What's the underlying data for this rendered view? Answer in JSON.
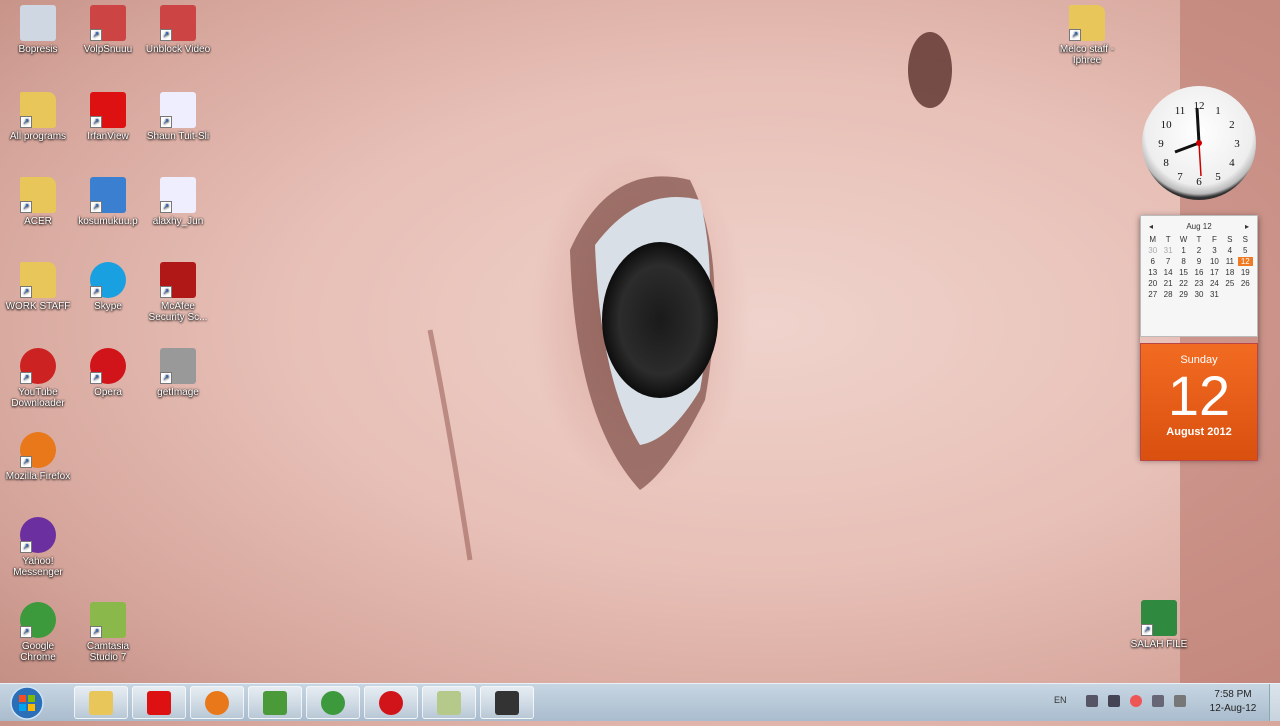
{
  "desktop_icons": [
    {
      "label": "Bopresis",
      "icon": "recycle-bin-icon"
    },
    {
      "label": "VolpSnuuu",
      "icon": "app-icon"
    },
    {
      "label": "Unblock Video",
      "icon": "app-icon"
    },
    {
      "label": "All programs",
      "icon": "folder-icon"
    },
    {
      "label": "IrfanView",
      "icon": "irfanview-icon"
    },
    {
      "label": "Shaun Tuit-Sli",
      "icon": "audio-file-icon"
    },
    {
      "label": "ACER",
      "icon": "folder-icon"
    },
    {
      "label": "kosumukuu.p",
      "icon": "computer-icon"
    },
    {
      "label": "alaxhy_Jun",
      "icon": "audio-file-icon"
    },
    {
      "label": "WORK STAFF",
      "icon": "folder-icon"
    },
    {
      "label": "Skype",
      "icon": "skype-icon"
    },
    {
      "label": "McAfee Security Sc...",
      "icon": "mcafee-icon"
    },
    {
      "label": "YouTube Downloader",
      "icon": "youtube-downloader-icon"
    },
    {
      "label": "Opera",
      "icon": "opera-icon"
    },
    {
      "label": "getImage",
      "icon": "file-icon"
    },
    {
      "label": "Mozilla Firefox",
      "icon": "firefox-icon"
    },
    {
      "label": "Yahoo! Messenger",
      "icon": "yahoo-messenger-icon"
    },
    {
      "label": "Google Chrome",
      "icon": "chrome-icon"
    },
    {
      "label": "Camtasia Studio 7",
      "icon": "camtasia-icon"
    },
    {
      "label": "Melco staff - Iphree",
      "icon": "folder-icon"
    },
    {
      "label": "SALAH FILE",
      "icon": "spreadsheet-icon"
    }
  ],
  "calendar": {
    "month_label": "Aug 12",
    "weekdays": [
      "M",
      "T",
      "W",
      "T",
      "F",
      "S",
      "S"
    ],
    "days": [
      {
        "d": "30",
        "dim": true
      },
      {
        "d": "31",
        "dim": true
      },
      {
        "d": "1"
      },
      {
        "d": "2"
      },
      {
        "d": "3"
      },
      {
        "d": "4"
      },
      {
        "d": "5"
      },
      {
        "d": "6"
      },
      {
        "d": "7"
      },
      {
        "d": "8"
      },
      {
        "d": "9"
      },
      {
        "d": "10"
      },
      {
        "d": "11"
      },
      {
        "d": "12",
        "today": true
      },
      {
        "d": "13"
      },
      {
        "d": "14"
      },
      {
        "d": "15"
      },
      {
        "d": "16"
      },
      {
        "d": "17"
      },
      {
        "d": "18"
      },
      {
        "d": "19"
      },
      {
        "d": "20"
      },
      {
        "d": "21"
      },
      {
        "d": "22"
      },
      {
        "d": "23"
      },
      {
        "d": "24"
      },
      {
        "d": "25"
      },
      {
        "d": "26"
      },
      {
        "d": "27"
      },
      {
        "d": "28"
      },
      {
        "d": "29"
      },
      {
        "d": "30"
      },
      {
        "d": "31"
      }
    ],
    "day_name": "Sunday",
    "day_number": "12",
    "month_year": "August 2012"
  },
  "clock_gadget": {
    "numbers": [
      "12",
      "1",
      "2",
      "3",
      "4",
      "5",
      "6",
      "7",
      "8",
      "9",
      "10",
      "11"
    ]
  },
  "taskbar": {
    "apps": [
      {
        "name": "explorer",
        "icon": "folder-icon"
      },
      {
        "name": "irfanview",
        "icon": "irfanview-icon"
      },
      {
        "name": "firefox",
        "icon": "firefox-icon"
      },
      {
        "name": "messenger",
        "icon": "messenger-icon"
      },
      {
        "name": "chrome",
        "icon": "chrome-icon"
      },
      {
        "name": "opera",
        "icon": "opera-icon"
      },
      {
        "name": "camtasia",
        "icon": "camtasia-icon"
      },
      {
        "name": "recorder",
        "icon": "recorder-icon"
      }
    ],
    "language": "EN",
    "time": "7:58 PM",
    "date": "12-Aug-12"
  }
}
